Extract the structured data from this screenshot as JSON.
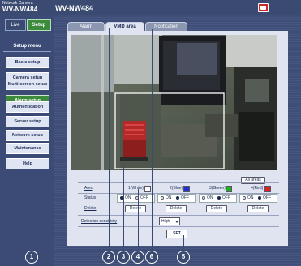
{
  "header": {
    "brand_line1": "Network Camera",
    "brand_line2": "WV-NW484",
    "model": "WV-NW484"
  },
  "mode": {
    "live_label": "Live",
    "setup_label": "Setup"
  },
  "sidebar": {
    "title": "Setup menu",
    "items": [
      {
        "label": "Basic setup"
      },
      {
        "label": "Camera setup"
      },
      {
        "label": "Multi-screen setup"
      },
      {
        "label": "Alarm setup"
      },
      {
        "label": "Authentication setup"
      },
      {
        "label": "Server setup"
      },
      {
        "label": "Network setup"
      },
      {
        "label": "Maintenance"
      },
      {
        "label": "Help"
      }
    ]
  },
  "tabs": [
    {
      "label": "Alarm"
    },
    {
      "label": "VMD area"
    },
    {
      "label": "Notification"
    }
  ],
  "areas": {
    "all_areas_label": "All areas",
    "area_label": "Area",
    "status_label": "Status",
    "delete_row_label": "Delete",
    "columns": [
      "1(White)",
      "2(Blue)",
      "3(Green)",
      "4(Red)"
    ],
    "column_colors": [
      "#ffffff",
      "#2030d0",
      "#20b020",
      "#e02020"
    ],
    "on_label": "ON",
    "off_label": "OFF",
    "delete_button_label": "Delete"
  },
  "sensitivity": {
    "label": "Detection sensitivity",
    "value": "High"
  },
  "set_label": "SET",
  "callouts": [
    "1",
    "2",
    "3",
    "4",
    "5",
    "6"
  ]
}
